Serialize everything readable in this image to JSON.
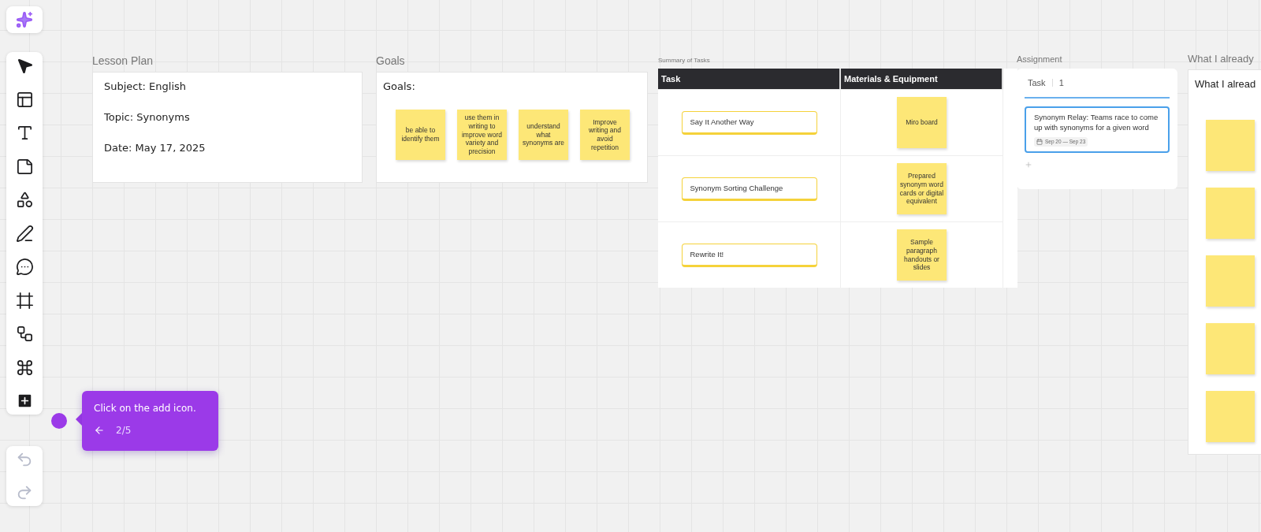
{
  "lesson_plan": {
    "label": "Lesson Plan",
    "lines": [
      "Subject: English",
      "Topic: Synonyms",
      "Date: May 17, 2025"
    ]
  },
  "goals": {
    "label": "Goals",
    "heading": "Goals:",
    "notes": [
      "be able to identify them",
      "use them in writing to improve word variety and precision",
      "understand what synonyms are",
      "Improve writing and avoid repetition"
    ]
  },
  "summary": {
    "label": "Summary of Tasks",
    "columns": [
      "Task",
      "Materials & Equipment"
    ],
    "rows": [
      {
        "task": "Say It Another Way",
        "materials": "Miro board"
      },
      {
        "task": "Synonym Sorting Challenge",
        "materials": "Prepared synonym word cards or digital equivalent"
      },
      {
        "task": "Rewrite It!",
        "materials": "Sample paragraph handouts or slides"
      }
    ]
  },
  "assignment": {
    "label": "Assignment",
    "column": "Task",
    "count": "1",
    "card": {
      "text": "Synonym Relay: Teams race to come up with synonyms for a given word",
      "dates": "Sep 20 — Sep 23"
    }
  },
  "what_i_know": {
    "label": "What I already",
    "heading": "What I alread",
    "notes": [
      {
        "kind": "empty"
      },
      {
        "kind": "empty"
      },
      {
        "kind": "empty"
      },
      {
        "kind": "empty"
      },
      {
        "kind": "empty"
      }
    ]
  },
  "tooltip": {
    "text": "Click on the add icon.",
    "step": "2/5"
  }
}
